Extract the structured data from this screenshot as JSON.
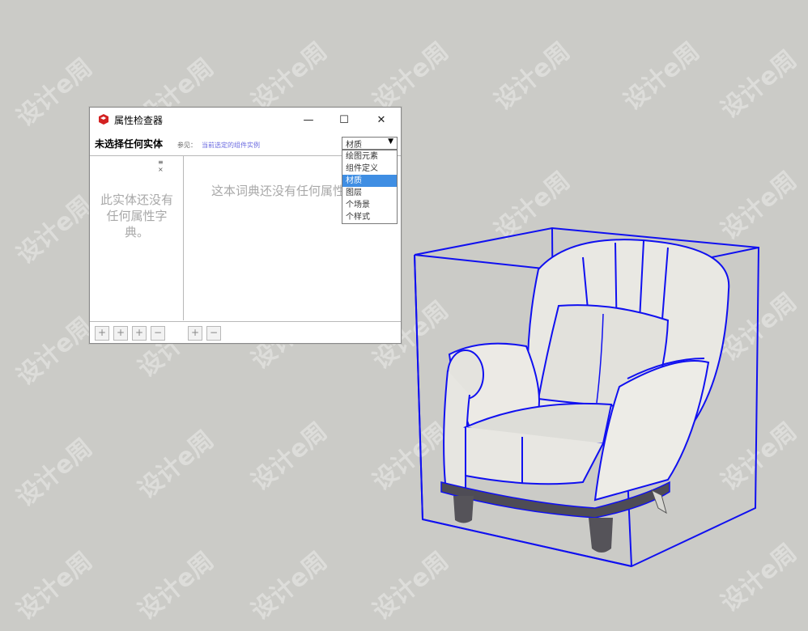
{
  "watermark": {
    "text": "设计e周"
  },
  "window": {
    "title": "属性检查器",
    "entity_label": "未选择任何实体",
    "see_also_label": "参见：",
    "see_also_link": "当前选定的组件实例",
    "empty_entity_text": "此实体还没有任何属性字典。",
    "empty_dict_text": "这本词典还没有任何属性。",
    "title_buttons": {
      "minimize": "—",
      "maximize": "☐",
      "close": "✕"
    }
  },
  "dropdown": {
    "value": "材质",
    "options": [
      "绘图元素",
      "组件定义",
      "材质",
      "图层",
      "个场景",
      "个样式"
    ],
    "selected_index": 2
  },
  "toolbar": {
    "left_buttons": [
      "+",
      "+",
      "+",
      "−"
    ],
    "right_buttons": [
      "+",
      "−"
    ]
  },
  "colors": {
    "background": "#cbcbc7",
    "bounding_box": "#1010f0",
    "selection": "#3f8ee3",
    "link": "#6a6ae0"
  }
}
